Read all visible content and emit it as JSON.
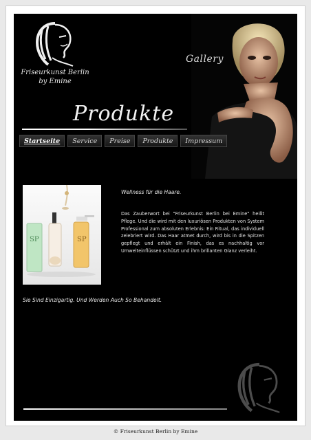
{
  "brand": {
    "name": "Friseurkunst Berlin",
    "sub": "by Emine",
    "logo_icon": "woman-face-logo-icon"
  },
  "header": {
    "gallery_label": "Gallery",
    "page_title": "Produkte"
  },
  "nav": {
    "items": [
      {
        "label": "Startseite",
        "active": true
      },
      {
        "label": "Service",
        "active": false
      },
      {
        "label": "Preise",
        "active": false
      },
      {
        "label": "Produkte",
        "active": false
      },
      {
        "label": "Impressum",
        "active": false
      }
    ]
  },
  "main": {
    "tagline": "Wellness für die Haare.",
    "body": "Das Zauberwort bei \"Friseurkunst Berlin bei Emine\" heißt Pflege. Und die wird mit den luxuriösen Produkten von System Professional zum absoluten Erlebnis: Ein Ritual, das individuell zelebriert wird. Das Haar atmet durch, wird bis in die Spitzen gepflegt und erhält ein Finish, das es nachhaltig vor Umwelteinflüssen schützt und ihm brillanten Glanz verleiht.",
    "slogan": "Sie Sind Einzigartig. Und Werden Auch So Behandelt.",
    "product_label": "SP"
  },
  "footer": {
    "copyright": "© Friseurkunst Berlin by Emine"
  },
  "colors": {
    "background": "#000000",
    "page": "#e9e9e9",
    "text": "#e6e6e6"
  }
}
